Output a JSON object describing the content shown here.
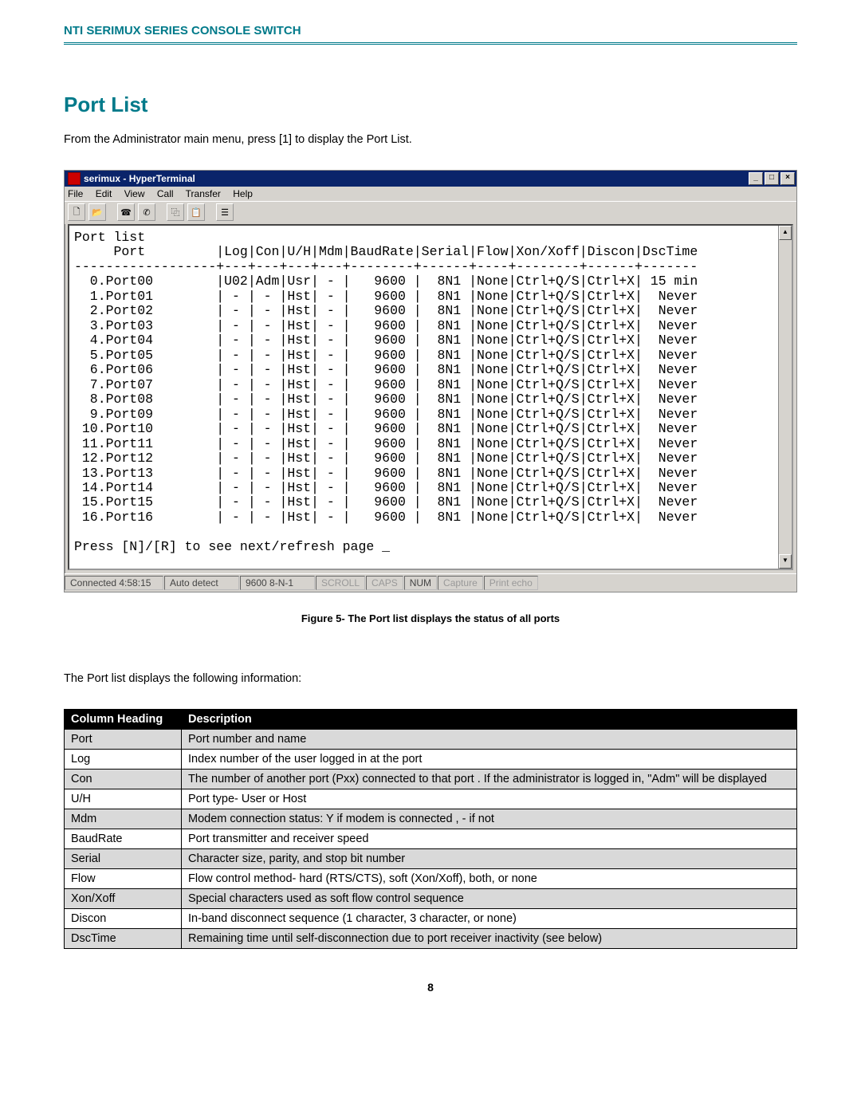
{
  "doc_header": "NTI SERIMUX SERIES CONSOLE SWITCH",
  "section_title": "Port List",
  "intro_text": "From the Administrator main menu, press [1] to display the Port List.",
  "window": {
    "title": "serimux - HyperTerminal",
    "menus": [
      "File",
      "Edit",
      "View",
      "Call",
      "Transfer",
      "Help"
    ],
    "toolbar_icons": [
      "new-doc-icon",
      "open-doc-icon",
      "phone-icon",
      "hangup-icon",
      "copy-icon",
      "paste-icon",
      "properties-icon"
    ],
    "winbtns": {
      "min": "_",
      "max": "□",
      "close": "×"
    }
  },
  "terminal": {
    "heading": "Port list",
    "column_header": "     Port         |Log|Con|U/H|Mdm|BaudRate|Serial|Flow|Xon/Xoff|Discon|DscTime",
    "divider": "------------------+---+---+---+---+--------+------+----+--------+------+-------",
    "rows": [
      "  0.Port00        |U02|Adm|Usr| - |   9600 |  8N1 |None|Ctrl+Q/S|Ctrl+X| 15 min",
      "  1.Port01        | - | - |Hst| - |   9600 |  8N1 |None|Ctrl+Q/S|Ctrl+X|  Never",
      "  2.Port02        | - | - |Hst| - |   9600 |  8N1 |None|Ctrl+Q/S|Ctrl+X|  Never",
      "  3.Port03        | - | - |Hst| - |   9600 |  8N1 |None|Ctrl+Q/S|Ctrl+X|  Never",
      "  4.Port04        | - | - |Hst| - |   9600 |  8N1 |None|Ctrl+Q/S|Ctrl+X|  Never",
      "  5.Port05        | - | - |Hst| - |   9600 |  8N1 |None|Ctrl+Q/S|Ctrl+X|  Never",
      "  6.Port06        | - | - |Hst| - |   9600 |  8N1 |None|Ctrl+Q/S|Ctrl+X|  Never",
      "  7.Port07        | - | - |Hst| - |   9600 |  8N1 |None|Ctrl+Q/S|Ctrl+X|  Never",
      "  8.Port08        | - | - |Hst| - |   9600 |  8N1 |None|Ctrl+Q/S|Ctrl+X|  Never",
      "  9.Port09        | - | - |Hst| - |   9600 |  8N1 |None|Ctrl+Q/S|Ctrl+X|  Never",
      " 10.Port10        | - | - |Hst| - |   9600 |  8N1 |None|Ctrl+Q/S|Ctrl+X|  Never",
      " 11.Port11        | - | - |Hst| - |   9600 |  8N1 |None|Ctrl+Q/S|Ctrl+X|  Never",
      " 12.Port12        | - | - |Hst| - |   9600 |  8N1 |None|Ctrl+Q/S|Ctrl+X|  Never",
      " 13.Port13        | - | - |Hst| - |   9600 |  8N1 |None|Ctrl+Q/S|Ctrl+X|  Never",
      " 14.Port14        | - | - |Hst| - |   9600 |  8N1 |None|Ctrl+Q/S|Ctrl+X|  Never",
      " 15.Port15        | - | - |Hst| - |   9600 |  8N1 |None|Ctrl+Q/S|Ctrl+X|  Never",
      " 16.Port16        | - | - |Hst| - |   9600 |  8N1 |None|Ctrl+Q/S|Ctrl+X|  Never"
    ],
    "prompt": "Press [N]/[R] to see next/refresh page _"
  },
  "statusbar": {
    "connected": "Connected 4:58:15",
    "detect": "Auto detect",
    "settings": "9600 8-N-1",
    "scroll": "SCROLL",
    "caps": "CAPS",
    "num": "NUM",
    "capture": "Capture",
    "echo": "Print echo"
  },
  "figure_caption": "Figure 5- The Port list displays the status of all ports",
  "table_intro": "The Port list displays the following information:",
  "info_table": {
    "headers": [
      "Column Heading",
      "Description"
    ],
    "rows": [
      {
        "h": "Port",
        "d": "Port number and name"
      },
      {
        "h": "Log",
        "d": "Index number of the user logged in at the port"
      },
      {
        "h": "Con",
        "d": "The number of another port (Pxx) connected to that port .   If the administrator is logged in,  \"Adm\" will be displayed"
      },
      {
        "h": "U/H",
        "d": "Port type- User or Host"
      },
      {
        "h": "Mdm",
        "d": "Modem connection status:   Y if modem is connected ,  -  if not"
      },
      {
        "h": "BaudRate",
        "d": "Port transmitter and receiver speed"
      },
      {
        "h": "Serial",
        "d": "Character size, parity, and stop bit number"
      },
      {
        "h": "Flow",
        "d": "Flow control method-  hard (RTS/CTS), soft (Xon/Xoff), both, or none"
      },
      {
        "h": "Xon/Xoff",
        "d": "Special characters used as soft flow control sequence"
      },
      {
        "h": "Discon",
        "d": "In-band disconnect sequence (1 character, 3 character, or none)"
      },
      {
        "h": "DscTime",
        "d": "Remaining time until self-disconnection due to port receiver inactivity (see below)"
      }
    ]
  },
  "page_number": "8"
}
